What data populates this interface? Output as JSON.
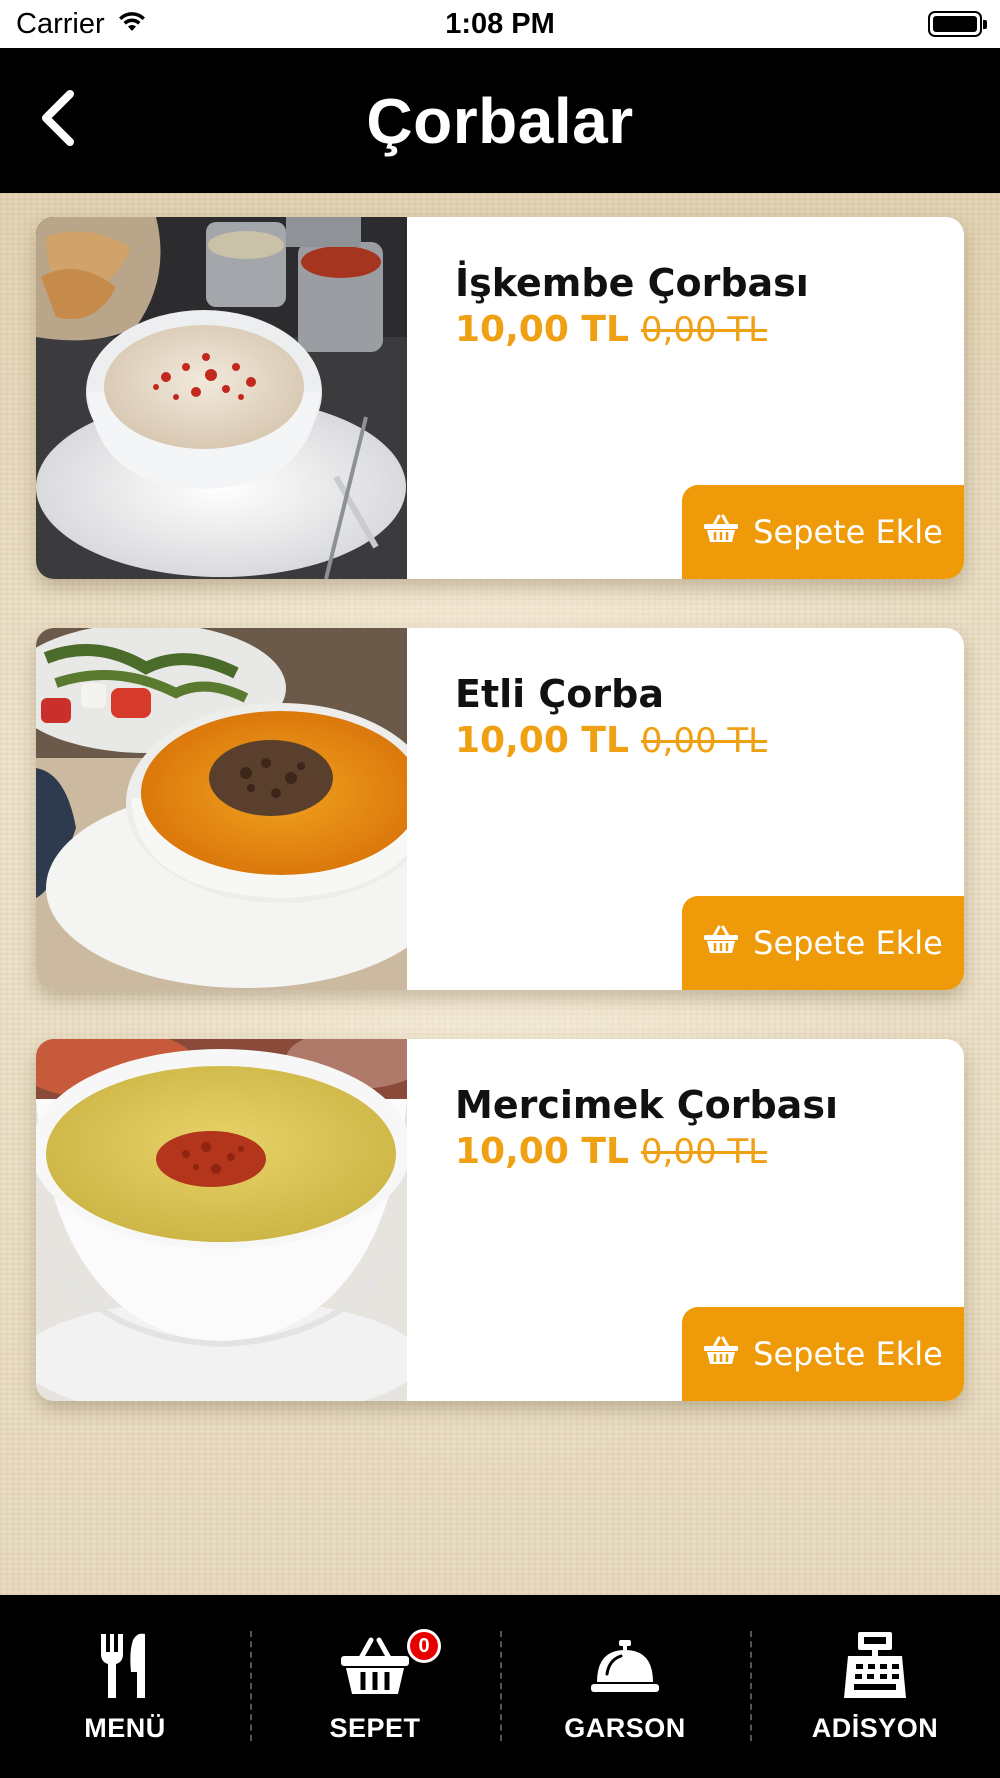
{
  "status_bar": {
    "carrier": "Carrier",
    "time": "1:08 PM"
  },
  "header": {
    "title": "Çorbalar",
    "back_icon": "chevron-left-icon"
  },
  "products": [
    {
      "name": "İşkembe Çorbası",
      "price": "10,00 TL",
      "old_price": "0,00 TL",
      "button_label": "Sepete Ekle",
      "image": "tripe-soup-photo"
    },
    {
      "name": "Etli Çorba",
      "price": "10,00 TL",
      "old_price": "0,00 TL",
      "button_label": "Sepete Ekle",
      "image": "meat-soup-photo"
    },
    {
      "name": "Mercimek Çorbası",
      "price": "10,00 TL",
      "old_price": "0,00 TL",
      "button_label": "Sepete Ekle",
      "image": "lentil-soup-photo"
    }
  ],
  "tab_bar": {
    "tabs": [
      {
        "label": "MENÜ",
        "icon": "fork-knife-icon"
      },
      {
        "label": "SEPET",
        "icon": "basket-icon",
        "badge": "0"
      },
      {
        "label": "GARSON",
        "icon": "service-bell-icon"
      },
      {
        "label": "ADİSYON",
        "icon": "cash-register-icon"
      }
    ]
  },
  "colors": {
    "accent": "#ef9a09",
    "price": "#f0a013",
    "header_bg": "#000000",
    "badge": "#e60000"
  }
}
